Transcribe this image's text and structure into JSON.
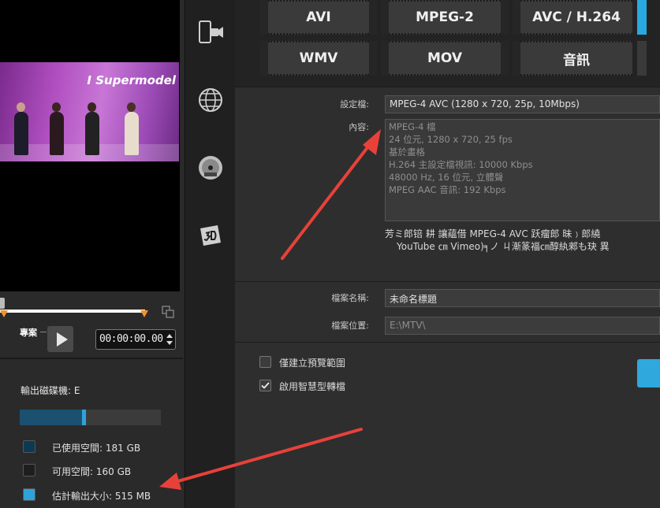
{
  "preview": {
    "brand_text": "I Supermodel",
    "mode_label": "專案",
    "timecode": "00:00:00.00"
  },
  "disk": {
    "label": "輸出磁碟機: E",
    "used_fraction": 0.44,
    "estimate_fraction": 0.03,
    "legend": [
      {
        "text": "已使用空間:  181 GB",
        "color": "#0d3a52"
      },
      {
        "text": "可用空間:  160 GB",
        "color": "#1e1e1e"
      },
      {
        "text": "估計輸出大小:  515 MB",
        "color": "#2fa3d8"
      }
    ]
  },
  "categories": [
    {
      "icon": "device-icon"
    },
    {
      "icon": "globe-icon"
    },
    {
      "icon": "dvd-icon"
    },
    {
      "icon": "3d-icon"
    }
  ],
  "formats": {
    "row1": [
      "AVI",
      "MPEG-2",
      "AVC / H.264"
    ],
    "row2": [
      "WMV",
      "MOV",
      "音訊"
    ]
  },
  "settings": {
    "profile_label": "設定檔:",
    "profile_value": "MPEG-4 AVC (1280 x 720, 25p, 10Mbps)",
    "content_label": "內容:",
    "content_lines": [
      "MPEG-4 檔",
      "24 位元, 1280 x 720, 25 fps",
      "基於畫格",
      "H.264 主設定檔視訊: 10000 Kbps",
      "48000 Hz, 16 位元, 立體聲",
      "MPEG AAC 音訊: 192 Kbps"
    ],
    "note_line1": "芳ミ郎锫      耕     讓蘊借 MPEG-4 AVC 跃瘤郎      昧﹚郎繞",
    "note_line2": "YouTube ㎝ Vimeo)╕ノ   ㄐ漸篆福㎝醇紈郲も玦   異"
  },
  "file": {
    "name_label": "檔案名稱:",
    "name_value": "未命名標題",
    "location_label": "檔案位置:",
    "location_value": "E:\\MTV\\"
  },
  "options": [
    {
      "label": "僅建立預覽範圍",
      "checked": false
    },
    {
      "label": "啟用智慧型轉檔",
      "checked": true
    }
  ],
  "colors": {
    "accent": "#2fa8de",
    "annotation_arrow": "#e8413a",
    "marker": "#f0932e"
  }
}
